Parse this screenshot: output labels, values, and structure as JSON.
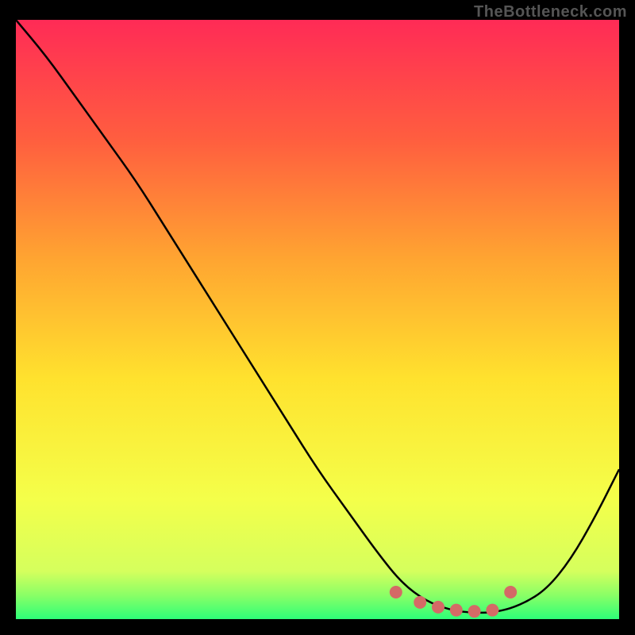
{
  "watermark": "TheBottleneck.com",
  "chart_data": {
    "type": "line",
    "title": "",
    "xlabel": "",
    "ylabel": "",
    "xlim": [
      0,
      100
    ],
    "ylim": [
      0,
      100
    ],
    "grid": false,
    "series": [
      {
        "name": "curve",
        "stroke": "#000000",
        "x": [
          0,
          5,
          10,
          15,
          20,
          25,
          30,
          35,
          40,
          45,
          50,
          55,
          60,
          64,
          68,
          72,
          76,
          80,
          84,
          88,
          92,
          96,
          100
        ],
        "y": [
          100,
          94,
          87,
          80,
          73,
          65,
          57,
          49,
          41,
          33,
          25,
          18,
          11,
          6,
          3,
          1.5,
          1,
          1.2,
          2.5,
          5,
          10,
          17,
          25
        ]
      }
    ],
    "markers": {
      "name": "red-dots",
      "color": "#d46a66",
      "radius_px": 8,
      "x": [
        63,
        67,
        70,
        73,
        76,
        79,
        82
      ],
      "y": [
        4.5,
        2.8,
        2,
        1.5,
        1.3,
        1.5,
        4.5
      ]
    },
    "gradient_stops": [
      {
        "offset": 0.0,
        "color": "#ff2b56"
      },
      {
        "offset": 0.2,
        "color": "#ff5e3f"
      },
      {
        "offset": 0.4,
        "color": "#ffa531"
      },
      {
        "offset": 0.6,
        "color": "#ffe22e"
      },
      {
        "offset": 0.8,
        "color": "#f4ff4a"
      },
      {
        "offset": 0.92,
        "color": "#d5ff5d"
      },
      {
        "offset": 0.96,
        "color": "#8aff66"
      },
      {
        "offset": 1.0,
        "color": "#2dff78"
      }
    ]
  }
}
